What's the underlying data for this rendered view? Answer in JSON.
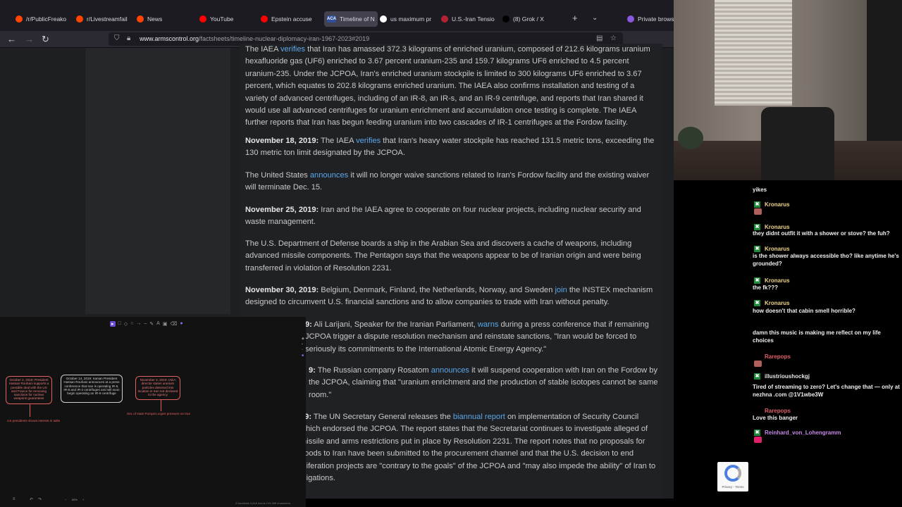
{
  "tabs": [
    {
      "label": "/r/PublicFreako",
      "icon": "reddit-icon",
      "color": "#ff4500"
    },
    {
      "label": "r/Livestreamfail",
      "icon": "reddit-icon",
      "color": "#ff4500"
    },
    {
      "label": "News",
      "icon": "reddit-icon",
      "color": "#ff4500"
    },
    {
      "label": "YouTube",
      "icon": "youtube-icon",
      "color": "#ff0000"
    },
    {
      "label": "Epstein accuse",
      "icon": "youtube-icon",
      "color": "#ff0000"
    },
    {
      "label": "Timeline of N",
      "icon": "aca-icon",
      "color": "#2f4f9a",
      "active": true
    },
    {
      "label": "us maximum pr",
      "icon": "google-icon",
      "color": "#ffffff"
    },
    {
      "label": "U.S.-Iran Tensio",
      "icon": "flag-icon",
      "color": "#b22234"
    },
    {
      "label": "(8) Grok / X",
      "icon": "x-icon",
      "color": "#000000"
    }
  ],
  "private_browsing": "Private browsi",
  "aca_fav_text": "ACA",
  "url": {
    "host": "www.armscontrol.org",
    "path": "/factsheets/timeline-nuclear-diplomacy-iran-1967-2023#2019"
  },
  "article": [
    {
      "date": "",
      "parts": [
        {
          "t": "The IAEA "
        },
        {
          "t": "verifies",
          "link": true
        },
        {
          "t": " that Iran has amassed 372.3 kilograms of enriched uranium, composed of 212.6 kilograms uranium hexafluoride gas (UF6) enriched to 3.67 percent uranium-235 and 159.7 kilograms UF6 enriched to 4.5 percent uranium-235. Under the JCPOA, Iran's enriched uranium stockpile is limited to 300 kilograms UF6 enriched to 3.67 percent, which equates to 202.8 kilograms enriched uranium. The IAEA also confirms installation and testing of a variety of advanced centrifuges, including of an IR-8, an IR-s, and an IR-9 centrifuge, and reports that Iran shared it would use all advanced centrifuges for uranium enrichment and accumulation once testing is complete. The IAEA further reports that Iran has begun feeding uranium into two cascades of IR-1 centrifuges at the Fordow facility."
        }
      ]
    },
    {
      "date": "November 18, 2019:",
      "parts": [
        {
          "t": " The IAEA "
        },
        {
          "t": "verifies",
          "link": true
        },
        {
          "t": " that Iran's heavy water stockpile has reached 131.5 metric tons, exceeding the 130 metric ton limit designated by the JCPOA."
        }
      ]
    },
    {
      "date": "",
      "parts": [
        {
          "t": "The United States "
        },
        {
          "t": "announces",
          "link": true
        },
        {
          "t": " it will no longer waive sanctions related to Iran's Fordow facility and the existing waiver will terminate Dec. 15."
        }
      ]
    },
    {
      "date": "November 25, 2019:",
      "parts": [
        {
          "t": " Iran and the IAEA agree to cooperate on four nuclear projects, including nuclear security and waste management."
        }
      ]
    },
    {
      "date": "",
      "parts": [
        {
          "t": "The U.S. Department of Defense boards a ship in the Arabian Sea and discovers a cache of weapons, including advanced missile components. The Pentagon says that the weapons appear to be of Iranian origin and were being transferred in violation of Resolution 2231."
        }
      ]
    },
    {
      "date": "November 30, 2019:",
      "parts": [
        {
          "t": " Belgium, Denmark, Finland, the Netherlands, Norway, and Sweden "
        },
        {
          "t": "join",
          "link": true
        },
        {
          "t": " the INSTEX mechanism designed to circumvent U.S. financial sanctions and to allow companies to trade with Iran without penalty."
        }
      ]
    },
    {
      "date": "9:",
      "parts": [
        {
          "t": " Ali Larijani, Speaker for the Iranian Parliament, "
        },
        {
          "t": "warns",
          "link": true
        },
        {
          "t": " during a press conference that if remaining JCPOA trigger a dispute resolution mechanism and reinstate sanctions, \"Iran would be forced to seriously its commitments to the International Atomic Energy Agency.\""
        }
      ]
    },
    {
      "date": "9:",
      "parts": [
        {
          "t": " The Russian company Rosatom "
        },
        {
          "t": "announces",
          "link": true
        },
        {
          "t": " it will suspend cooperation with Iran on the Fordow by the JCPOA, claiming that \"uranium enrichment and the production of stable isotopes cannot be same room.\""
        }
      ]
    },
    {
      "date": "19:",
      "parts": [
        {
          "t": " The UN Secretary General releases the "
        },
        {
          "t": "biannual report",
          "link": true
        },
        {
          "t": " on implementation of Security Council which endorsed the JCPOA. The report states that the Secretariat continues to investigate alleged of missile and arms restrictions put in place by Resolution 2231. The report notes that no proposals for goods to Iran have been submitted to the procurement channel and that the U.S. decision to end oliferation projects are \"contrary to the goals\" of the JCPOA and \"may also impede the ability\" of Iran to bligations."
        }
      ]
    }
  ],
  "board": {
    "cards": [
      {
        "text": "October 2, 2019: President Hassan Rouhani supports a possible deal with the US and France for removing sanctions for nuclear weapons guarantees",
        "style": "red"
      },
      {
        "text": "October 14, 2019: Iranian President Hassan Rouhani announces at a press conference that Iran is operating IR-6, IR-8 and IR-2 centrifuges and will soon begin operating an IR-9 centrifuge",
        "style": "wht"
      },
      {
        "text": "November 3, 2019: IAEA director states uranium particles detected into location in Iran not declared to the agency",
        "style": "red"
      }
    ],
    "notes": [
      "US presidents shows interest in talks",
      "Sec of state Pompeo urges pressure on Iran"
    ],
    "zoom": "68%",
    "stats": "0 backlinks 3,818 words 214,068 characters"
  },
  "chat": [
    {
      "type": "msg",
      "text": "yikes"
    },
    {
      "type": "emote",
      "color": "#b0605a"
    },
    {
      "type": "user",
      "name": "Kronarus",
      "color": "#f0d48a"
    },
    {
      "type": "msg",
      "text": "they didnt outfit it with a shower or stove? the fuh?"
    },
    {
      "type": "user",
      "name": "Kronarus",
      "color": "#f0d48a"
    },
    {
      "type": "msg",
      "text": "is the shower always accessible tho? like anytime he's grounded?"
    },
    {
      "type": "user",
      "name": "Kronarus",
      "color": "#f0d48a"
    },
    {
      "type": "msg",
      "text": "the fk???"
    },
    {
      "type": "user",
      "name": "Kronarus",
      "color": "#f0d48a"
    },
    {
      "type": "msg",
      "text": "how doesn't that cabin smell horrible?"
    },
    {
      "type": "user",
      "name": "Kronarus",
      "color": "#f0d48a"
    },
    {
      "type": "msg",
      "text": "damn this music is making me reflect on my life choices"
    },
    {
      "type": "user",
      "name": "Rarepops",
      "color": "#e0606a",
      "nobadge": true
    },
    {
      "type": "emote",
      "color": "#b0605a"
    },
    {
      "type": "user",
      "name": "illustrioushockgj",
      "color": "#e6e6e6"
    },
    {
      "type": "msg",
      "text": "Tired of streaming to zero? Let's change that — only at nezhna .com @1V1wbe3W"
    },
    {
      "type": "user",
      "name": "Rarepops",
      "color": "#e0606a",
      "nobadge": true
    },
    {
      "type": "msg",
      "text": "Love this banger"
    },
    {
      "type": "user",
      "name": "Reinhard_von_Lohengramm",
      "color": "#c78ae8"
    },
    {
      "type": "emote",
      "color": "#e0206a"
    }
  ],
  "captcha": {
    "label": "Privacy - Terms"
  },
  "colors": {
    "chrome": "#1c1b22",
    "page": "#202124",
    "link": "#5aa7e8"
  }
}
